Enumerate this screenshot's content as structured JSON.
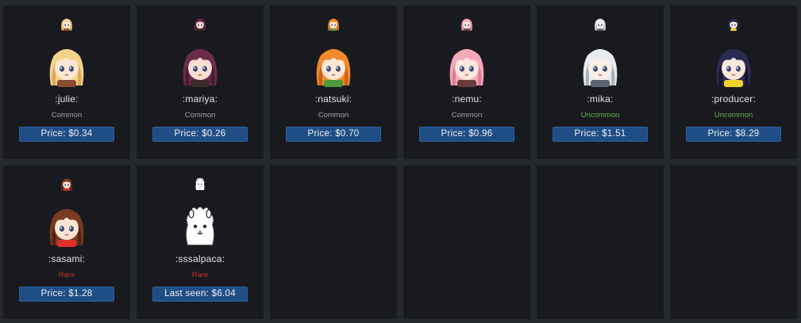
{
  "colors": {
    "common": "#a4a4a4",
    "uncommon": "#6ab04c",
    "rare": "#c8322d"
  },
  "cards": [
    {
      "name": ":julie:",
      "rarity": "Common",
      "rarity_key": "common",
      "price_label": "Price: $0.34",
      "icon": "julie-emote-icon",
      "hair": "#f3d28a",
      "hair_dark": "#d9a95a",
      "skin": "#fde7d6",
      "acc": "#8a4b2f"
    },
    {
      "name": ":mariya:",
      "rarity": "Common",
      "rarity_key": "common",
      "price_label": "Price: $0.26",
      "icon": "mariya-emote-icon",
      "hair": "#6d2b4a",
      "hair_dark": "#4a1b33",
      "skin": "#f8dfd2",
      "acc": "#3a2a2a"
    },
    {
      "name": ":natsuki:",
      "rarity": "Common",
      "rarity_key": "common",
      "price_label": "Price: $0.70",
      "icon": "natsuki-emote-icon",
      "hair": "#f08a2c",
      "hair_dark": "#c9631a",
      "skin": "#fde6d4",
      "acc": "#4f9a3c"
    },
    {
      "name": ":nemu:",
      "rarity": "Common",
      "rarity_key": "common",
      "price_label": "Price: $0.96",
      "icon": "nemu-emote-icon",
      "hair": "#f5a9bb",
      "hair_dark": "#e07d96",
      "skin": "#fde7dc",
      "acc": "#6a3b3b"
    },
    {
      "name": ":mika:",
      "rarity": "Uncommon",
      "rarity_key": "uncommon",
      "price_label": "Price: $1.51",
      "icon": "mika-emote-icon",
      "hair": "#e8ecf0",
      "hair_dark": "#aab3bd",
      "skin": "#fbefe6",
      "acc": "#5a6470"
    },
    {
      "name": ":producer:",
      "rarity": "Uncommon",
      "rarity_key": "uncommon",
      "price_label": "Price: $8.29",
      "icon": "producer-emote-icon",
      "hair": "#2c2a55",
      "hair_dark": "#16152e",
      "skin": "#fde8dc",
      "acc": "#f3d22b"
    },
    {
      "name": ":sasami:",
      "rarity": "Rare",
      "rarity_key": "rare",
      "price_label": "Price: $1.28",
      "icon": "sasami-emote-icon",
      "hair": "#7a3a22",
      "hair_dark": "#55240f",
      "skin": "#fde4d4",
      "acc": "#e0302c"
    },
    {
      "name": ":sssalpaca:",
      "rarity": "Rare",
      "rarity_key": "rare",
      "price_label": "Last seen: $6.04",
      "icon": "alpaca-emote-icon",
      "hair": "#ffffff",
      "hair_dark": "#d8d8d8",
      "skin": "#ffffff",
      "acc": "#2b2b2b"
    },
    {
      "empty": true
    },
    {
      "empty": true
    },
    {
      "empty": true
    },
    {
      "empty": true
    }
  ]
}
